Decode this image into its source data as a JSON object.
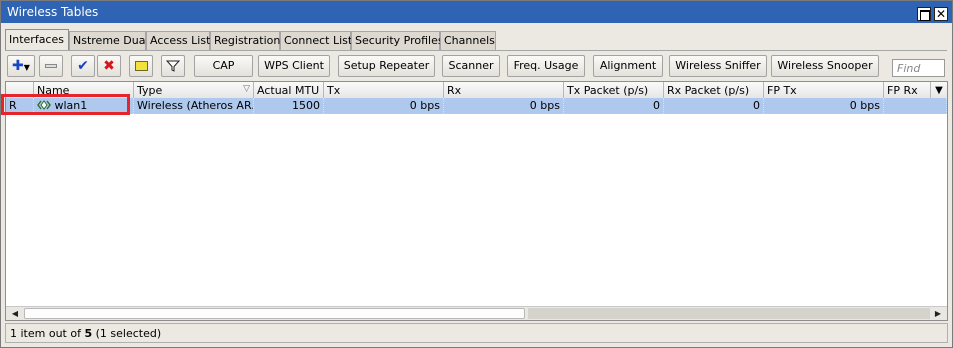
{
  "window": {
    "title": "Wireless Tables"
  },
  "tabs": [
    {
      "label": "Interfaces",
      "active": true
    },
    {
      "label": "Nstreme Dual"
    },
    {
      "label": "Access List"
    },
    {
      "label": "Registration"
    },
    {
      "label": "Connect List"
    },
    {
      "label": "Security Profiles"
    },
    {
      "label": "Channels"
    }
  ],
  "toolbar": {
    "add_icon": "plus-dropdown-icon",
    "remove_icon": "minus-icon",
    "enable_icon": "checkmark-icon",
    "disable_icon": "x-icon",
    "comment_icon": "note-icon",
    "filter_icon": "funnel-icon",
    "buttons": [
      "CAP",
      "WPS Client",
      "Setup Repeater",
      "Scanner",
      "Freq. Usage",
      "Alignment",
      "Wireless Sniffer",
      "Wireless Snooper"
    ],
    "find_placeholder": "Find"
  },
  "table": {
    "columns": [
      "Name",
      "Type",
      "Actual MTU",
      "Tx",
      "Rx",
      "Tx Packet (p/s)",
      "Rx Packet (p/s)",
      "FP Tx",
      "FP Rx"
    ],
    "rows": [
      {
        "flag": "R",
        "name": "wlan1",
        "type": "Wireless (Atheros AR...",
        "mtu": "1500",
        "tx": "0 bps",
        "rx": "0 bps",
        "tx_packet": "0",
        "rx_packet": "0",
        "fp_tx": "0 bps",
        "fp_rx": "",
        "selected": true
      }
    ]
  },
  "status": {
    "prefix": "1 item out of ",
    "total": "5",
    "suffix": " (1 selected)"
  },
  "colors": {
    "titlebar": "#2f63b3",
    "selected_row": "#aec8ee",
    "highlight": "#e5242c"
  }
}
